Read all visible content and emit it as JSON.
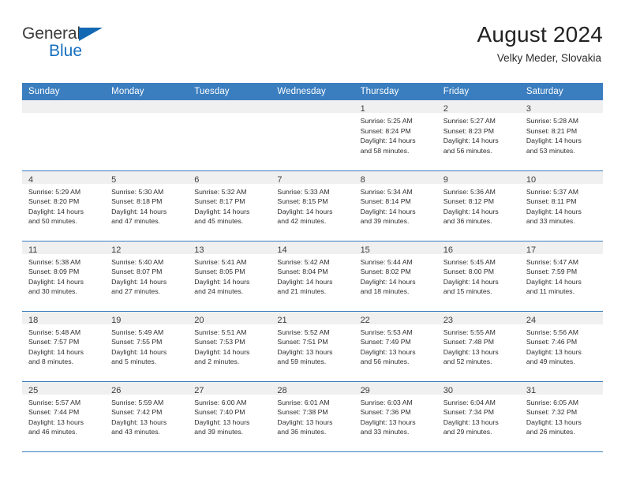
{
  "brand": {
    "name_part1": "General",
    "name_part2": "Blue",
    "flag_icon": "blue-triangle-flag-icon",
    "accent_color": "#1570bf"
  },
  "header": {
    "title": "August 2024",
    "subtitle": "Velky Meder, Slovakia"
  },
  "theme": {
    "header_band": "#3a7ebf",
    "daynum_strip": "#f0f0f0",
    "grid_line": "#3a7ebf",
    "text": "#2e2e2e"
  },
  "weekday_headers": [
    "Sunday",
    "Monday",
    "Tuesday",
    "Wednesday",
    "Thursday",
    "Friday",
    "Saturday"
  ],
  "calendar_data": {
    "month": "August",
    "year": "2024",
    "location": "Velky Meder, Slovakia",
    "first_day_column": 4,
    "weeks": [
      [
        {
          "day": "",
          "lines": []
        },
        {
          "day": "",
          "lines": []
        },
        {
          "day": "",
          "lines": []
        },
        {
          "day": "",
          "lines": []
        },
        {
          "day": "1",
          "lines": [
            "Sunrise: 5:25 AM",
            "Sunset: 8:24 PM",
            "Daylight: 14 hours",
            "and 58 minutes."
          ]
        },
        {
          "day": "2",
          "lines": [
            "Sunrise: 5:27 AM",
            "Sunset: 8:23 PM",
            "Daylight: 14 hours",
            "and 56 minutes."
          ]
        },
        {
          "day": "3",
          "lines": [
            "Sunrise: 5:28 AM",
            "Sunset: 8:21 PM",
            "Daylight: 14 hours",
            "and 53 minutes."
          ]
        }
      ],
      [
        {
          "day": "4",
          "lines": [
            "Sunrise: 5:29 AM",
            "Sunset: 8:20 PM",
            "Daylight: 14 hours",
            "and 50 minutes."
          ]
        },
        {
          "day": "5",
          "lines": [
            "Sunrise: 5:30 AM",
            "Sunset: 8:18 PM",
            "Daylight: 14 hours",
            "and 47 minutes."
          ]
        },
        {
          "day": "6",
          "lines": [
            "Sunrise: 5:32 AM",
            "Sunset: 8:17 PM",
            "Daylight: 14 hours",
            "and 45 minutes."
          ]
        },
        {
          "day": "7",
          "lines": [
            "Sunrise: 5:33 AM",
            "Sunset: 8:15 PM",
            "Daylight: 14 hours",
            "and 42 minutes."
          ]
        },
        {
          "day": "8",
          "lines": [
            "Sunrise: 5:34 AM",
            "Sunset: 8:14 PM",
            "Daylight: 14 hours",
            "and 39 minutes."
          ]
        },
        {
          "day": "9",
          "lines": [
            "Sunrise: 5:36 AM",
            "Sunset: 8:12 PM",
            "Daylight: 14 hours",
            "and 36 minutes."
          ]
        },
        {
          "day": "10",
          "lines": [
            "Sunrise: 5:37 AM",
            "Sunset: 8:11 PM",
            "Daylight: 14 hours",
            "and 33 minutes."
          ]
        }
      ],
      [
        {
          "day": "11",
          "lines": [
            "Sunrise: 5:38 AM",
            "Sunset: 8:09 PM",
            "Daylight: 14 hours",
            "and 30 minutes."
          ]
        },
        {
          "day": "12",
          "lines": [
            "Sunrise: 5:40 AM",
            "Sunset: 8:07 PM",
            "Daylight: 14 hours",
            "and 27 minutes."
          ]
        },
        {
          "day": "13",
          "lines": [
            "Sunrise: 5:41 AM",
            "Sunset: 8:05 PM",
            "Daylight: 14 hours",
            "and 24 minutes."
          ]
        },
        {
          "day": "14",
          "lines": [
            "Sunrise: 5:42 AM",
            "Sunset: 8:04 PM",
            "Daylight: 14 hours",
            "and 21 minutes."
          ]
        },
        {
          "day": "15",
          "lines": [
            "Sunrise: 5:44 AM",
            "Sunset: 8:02 PM",
            "Daylight: 14 hours",
            "and 18 minutes."
          ]
        },
        {
          "day": "16",
          "lines": [
            "Sunrise: 5:45 AM",
            "Sunset: 8:00 PM",
            "Daylight: 14 hours",
            "and 15 minutes."
          ]
        },
        {
          "day": "17",
          "lines": [
            "Sunrise: 5:47 AM",
            "Sunset: 7:59 PM",
            "Daylight: 14 hours",
            "and 11 minutes."
          ]
        }
      ],
      [
        {
          "day": "18",
          "lines": [
            "Sunrise: 5:48 AM",
            "Sunset: 7:57 PM",
            "Daylight: 14 hours",
            "and 8 minutes."
          ]
        },
        {
          "day": "19",
          "lines": [
            "Sunrise: 5:49 AM",
            "Sunset: 7:55 PM",
            "Daylight: 14 hours",
            "and 5 minutes."
          ]
        },
        {
          "day": "20",
          "lines": [
            "Sunrise: 5:51 AM",
            "Sunset: 7:53 PM",
            "Daylight: 14 hours",
            "and 2 minutes."
          ]
        },
        {
          "day": "21",
          "lines": [
            "Sunrise: 5:52 AM",
            "Sunset: 7:51 PM",
            "Daylight: 13 hours",
            "and 59 minutes."
          ]
        },
        {
          "day": "22",
          "lines": [
            "Sunrise: 5:53 AM",
            "Sunset: 7:49 PM",
            "Daylight: 13 hours",
            "and 56 minutes."
          ]
        },
        {
          "day": "23",
          "lines": [
            "Sunrise: 5:55 AM",
            "Sunset: 7:48 PM",
            "Daylight: 13 hours",
            "and 52 minutes."
          ]
        },
        {
          "day": "24",
          "lines": [
            "Sunrise: 5:56 AM",
            "Sunset: 7:46 PM",
            "Daylight: 13 hours",
            "and 49 minutes."
          ]
        }
      ],
      [
        {
          "day": "25",
          "lines": [
            "Sunrise: 5:57 AM",
            "Sunset: 7:44 PM",
            "Daylight: 13 hours",
            "and 46 minutes."
          ]
        },
        {
          "day": "26",
          "lines": [
            "Sunrise: 5:59 AM",
            "Sunset: 7:42 PM",
            "Daylight: 13 hours",
            "and 43 minutes."
          ]
        },
        {
          "day": "27",
          "lines": [
            "Sunrise: 6:00 AM",
            "Sunset: 7:40 PM",
            "Daylight: 13 hours",
            "and 39 minutes."
          ]
        },
        {
          "day": "28",
          "lines": [
            "Sunrise: 6:01 AM",
            "Sunset: 7:38 PM",
            "Daylight: 13 hours",
            "and 36 minutes."
          ]
        },
        {
          "day": "29",
          "lines": [
            "Sunrise: 6:03 AM",
            "Sunset: 7:36 PM",
            "Daylight: 13 hours",
            "and 33 minutes."
          ]
        },
        {
          "day": "30",
          "lines": [
            "Sunrise: 6:04 AM",
            "Sunset: 7:34 PM",
            "Daylight: 13 hours",
            "and 29 minutes."
          ]
        },
        {
          "day": "31",
          "lines": [
            "Sunrise: 6:05 AM",
            "Sunset: 7:32 PM",
            "Daylight: 13 hours",
            "and 26 minutes."
          ]
        }
      ]
    ]
  }
}
